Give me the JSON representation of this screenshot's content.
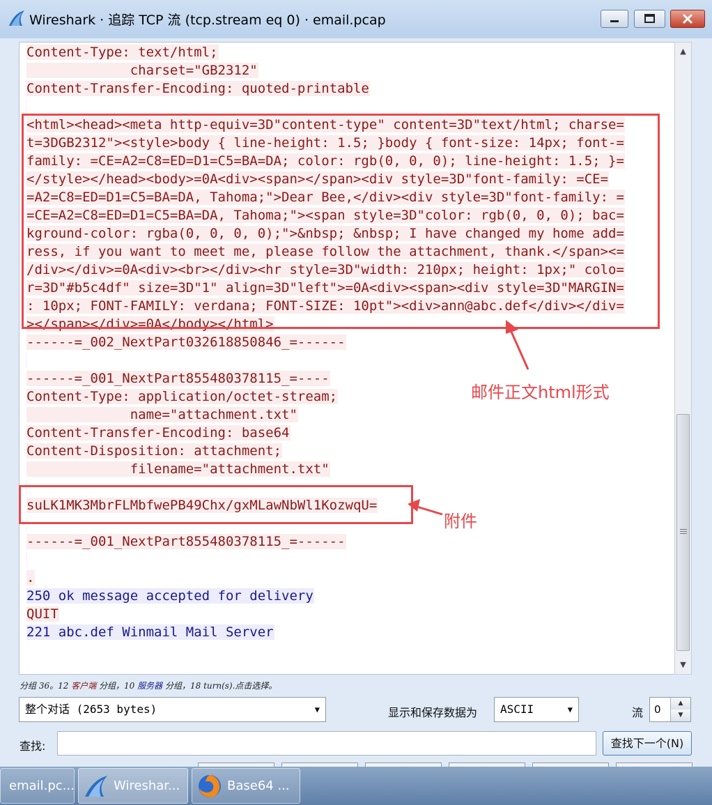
{
  "window": {
    "title": "Wireshark · 追踪 TCP 流 (tcp.stream eq 0) · email.pcap",
    "icon": "wireshark-fin-icon",
    "controls": [
      "minimize-icon",
      "maximize-icon",
      "close-icon"
    ]
  },
  "stream": {
    "lines": [
      {
        "text": "Content-Type: text/html;",
        "dir": "client"
      },
      {
        "text": "             charset=\"GB2312\"",
        "dir": "client"
      },
      {
        "text": "Content-Transfer-Encoding: quoted-printable",
        "dir": "client"
      },
      {
        "text": "",
        "dir": "client"
      },
      {
        "text": "<html><head><meta http-equiv=3D\"content-type\" content=3D\"text/html; charse=",
        "dir": "client"
      },
      {
        "text": "t=3DGB2312\"><style>body { line-height: 1.5; }body { font-size: 14px; font-=",
        "dir": "client"
      },
      {
        "text": "family: =CE=A2=C8=ED=D1=C5=BA=DA; color: rgb(0, 0, 0); line-height: 1.5; }=",
        "dir": "client"
      },
      {
        "text": "</style></head><body>=0A<div><span></span><div style=3D\"font-family: =CE=",
        "dir": "client"
      },
      {
        "text": "=A2=C8=ED=D1=C5=BA=DA, Tahoma;\">Dear Bee,</div><div style=3D\"font-family: =",
        "dir": "client"
      },
      {
        "text": "=CE=A2=C8=ED=D1=C5=BA=DA, Tahoma;\"><span style=3D\"color: rgb(0, 0, 0); bac=",
        "dir": "client"
      },
      {
        "text": "kground-color: rgba(0, 0, 0, 0);\">&nbsp; &nbsp; I have changed my home add=",
        "dir": "client"
      },
      {
        "text": "ress, if you want to meet me, please follow the attachment, thank.</span><=",
        "dir": "client"
      },
      {
        "text": "/div></div>=0A<div><br></div><hr style=3D\"width: 210px; height: 1px;\" colo=",
        "dir": "client"
      },
      {
        "text": "r=3D\"#b5c4df\" size=3D\"1\" align=3D\"left\">=0A<div><span><div style=3D\"MARGIN=",
        "dir": "client"
      },
      {
        "text": ": 10px; FONT-FAMILY: verdana; FONT-SIZE: 10pt\"><div>ann@abc.def</div></div=",
        "dir": "client"
      },
      {
        "text": "></span></div>=0A</body></html>",
        "dir": "client"
      },
      {
        "text": "------=_002_NextPart032618850846_=------",
        "dir": "client"
      },
      {
        "text": "",
        "dir": "client"
      },
      {
        "text": "------=_001_NextPart855480378115_=----",
        "dir": "client"
      },
      {
        "text": "Content-Type: application/octet-stream;",
        "dir": "client"
      },
      {
        "text": "             name=\"attachment.txt\"",
        "dir": "client"
      },
      {
        "text": "Content-Transfer-Encoding: base64",
        "dir": "client"
      },
      {
        "text": "Content-Disposition: attachment;",
        "dir": "client"
      },
      {
        "text": "             filename=\"attachment.txt\"",
        "dir": "client"
      },
      {
        "text": "",
        "dir": "client"
      },
      {
        "text": "suLK1MK3MbrFLMbfwePB49Chx/gxMLawNbWl1KozwqU=",
        "dir": "client"
      },
      {
        "text": "",
        "dir": "client"
      },
      {
        "text": "------=_001_NextPart855480378115_=------",
        "dir": "client"
      },
      {
        "text": "",
        "dir": "client"
      },
      {
        "text": ".",
        "dir": "client"
      },
      {
        "text": "250 ok message accepted for delivery",
        "dir": "server"
      },
      {
        "text": "QUIT",
        "dir": "client"
      },
      {
        "text": "221 abc.def Winmail Mail Server",
        "dir": "server"
      }
    ],
    "client_color": "#8b1a1a",
    "client_bg": "#fbeded",
    "server_color": "#1a1a8b",
    "server_bg": "#ececfb"
  },
  "annotations": {
    "html_label": "邮件正文html形式",
    "attachment_label": "附件",
    "color": "#e8474b"
  },
  "status": {
    "prefix": "分组 36。12",
    "client": "客户端",
    "mid": "分组，10",
    "server": "服务器",
    "suffix": "分组，18 turn(s).点击选择。"
  },
  "controls": {
    "conversation_select": "整个对话 (2653 bytes)",
    "show_as_label": "显示和保存数据为",
    "show_as_value": "ASCII",
    "stream_label": "流",
    "stream_value": "0",
    "find_label": "查找:",
    "find_placeholder": "",
    "find_next_button": "查找下一个(N)"
  },
  "taskbar": {
    "items": [
      {
        "label": "email.pc...",
        "icon": "pcap-file-icon"
      },
      {
        "label": "Wireshar...",
        "icon": "wireshark-fin-icon"
      },
      {
        "label": "Base64 ...",
        "icon": "firefox-icon"
      }
    ]
  }
}
